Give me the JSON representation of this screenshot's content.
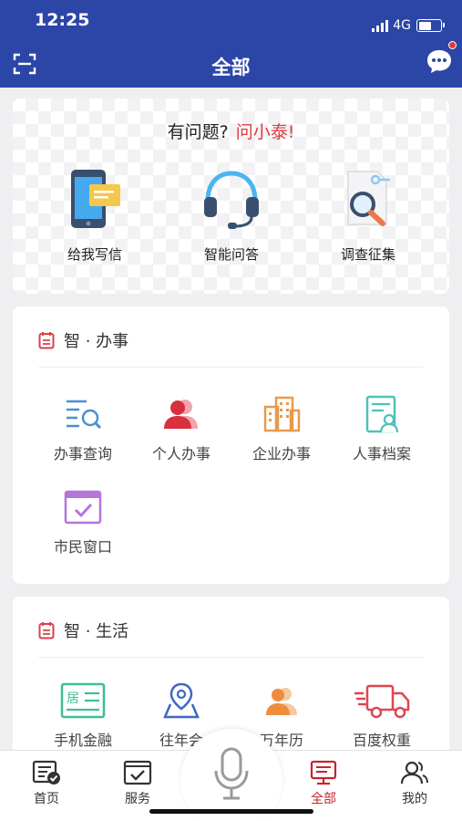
{
  "status": {
    "time": "12:25",
    "network": "4G"
  },
  "header": {
    "title": "全部"
  },
  "ask": {
    "question": "有问题?",
    "highlight": "问小泰!",
    "items": [
      {
        "label": "给我写信",
        "icon": "phone-letter-icon"
      },
      {
        "label": "智能问答",
        "icon": "headset-icon"
      },
      {
        "label": "调查征集",
        "icon": "search-survey-icon"
      }
    ]
  },
  "sections": [
    {
      "title": "智 · 办事",
      "items": [
        {
          "label": "办事查询",
          "icon": "list-search-icon"
        },
        {
          "label": "个人办事",
          "icon": "users-icon"
        },
        {
          "label": "企业办事",
          "icon": "building-icon"
        },
        {
          "label": "人事档案",
          "icon": "profile-card-icon"
        },
        {
          "label": "市民窗口",
          "icon": "window-check-icon"
        }
      ]
    },
    {
      "title": "智 · 生活",
      "items": [
        {
          "label": "手机金融",
          "icon": "residence-card-icon"
        },
        {
          "label": "往年会",
          "icon": "map-pin-icon"
        },
        {
          "label": "万年历",
          "icon": "people-icon"
        },
        {
          "label": "百度权重",
          "icon": "truck-icon"
        }
      ]
    }
  ],
  "tabbar": {
    "items": [
      {
        "label": "首页",
        "icon": "home-news-icon",
        "active": false
      },
      {
        "label": "服务",
        "icon": "service-icon",
        "active": false
      },
      {
        "label": "",
        "icon": "microphone-icon",
        "active": false
      },
      {
        "label": "全部",
        "icon": "all-apps-icon",
        "active": true
      },
      {
        "label": "我的",
        "icon": "profile-icon",
        "active": false
      }
    ]
  },
  "colors": {
    "brand": "#2c46a8",
    "accent": "#e0393e",
    "active_tab": "#c8242e"
  }
}
